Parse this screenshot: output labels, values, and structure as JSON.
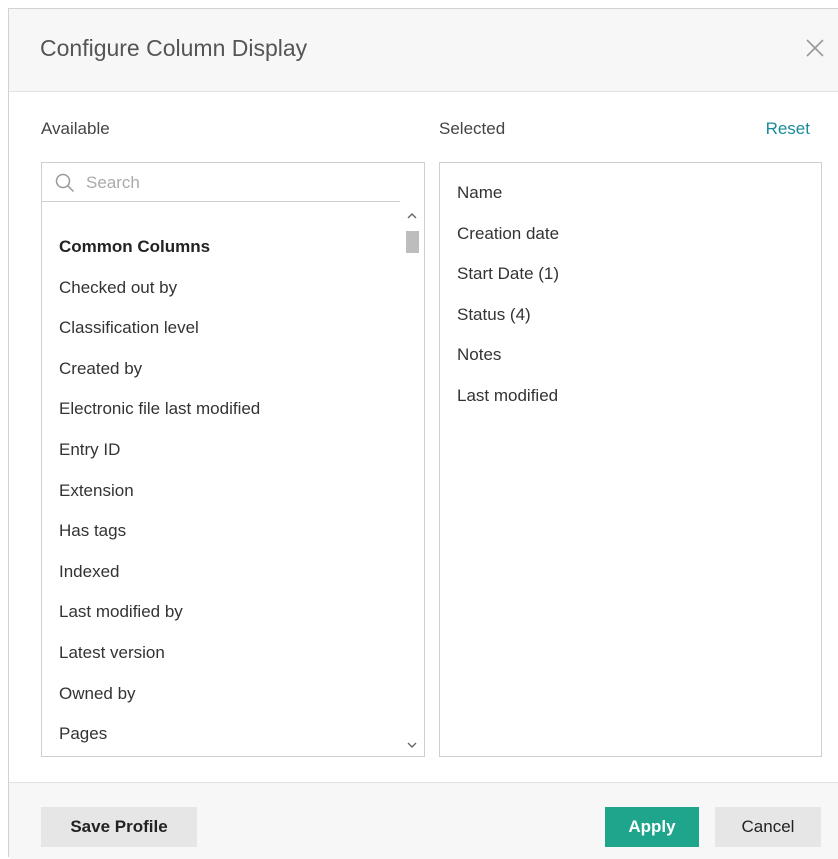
{
  "dialog": {
    "title": "Configure Column Display",
    "close_icon": "close-icon"
  },
  "available": {
    "label": "Available",
    "search_placeholder": "Search",
    "items": [
      {
        "label": "Common Columns",
        "group": true
      },
      {
        "label": "Checked out by"
      },
      {
        "label": "Classification level"
      },
      {
        "label": "Created by"
      },
      {
        "label": "Electronic file last modified"
      },
      {
        "label": "Entry ID"
      },
      {
        "label": "Extension"
      },
      {
        "label": "Has tags"
      },
      {
        "label": "Indexed"
      },
      {
        "label": "Last modified by"
      },
      {
        "label": "Latest version"
      },
      {
        "label": "Owned by"
      },
      {
        "label": "Pages"
      }
    ]
  },
  "selected": {
    "label": "Selected",
    "reset_label": "Reset",
    "items": [
      {
        "label": "Name"
      },
      {
        "label": "Creation date"
      },
      {
        "label": "Start Date (1)"
      },
      {
        "label": "Status (4)"
      },
      {
        "label": "Notes"
      },
      {
        "label": "Last modified"
      }
    ]
  },
  "footer": {
    "save_profile_label": "Save Profile",
    "apply_label": "Apply",
    "cancel_label": "Cancel"
  },
  "colors": {
    "accent": "#1fa58b",
    "link": "#1a8a9a"
  }
}
